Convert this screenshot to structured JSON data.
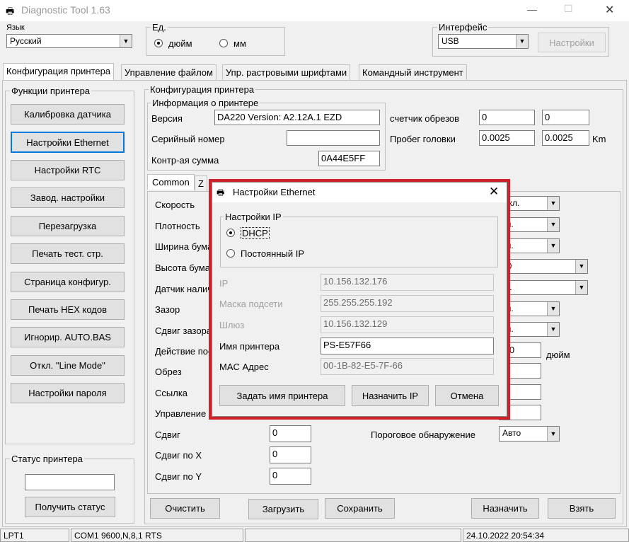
{
  "window": {
    "title": "Diagnostic Tool 1.63",
    "min": "—",
    "max": "☐",
    "close": "✕"
  },
  "lang": {
    "label": "Язык",
    "value": "Русский"
  },
  "units": {
    "label": "Ед.",
    "inch": "дюйм",
    "mm": "мм"
  },
  "iface": {
    "label": "Интерфейс",
    "value": "USB",
    "settings": "Настройки"
  },
  "tabs": [
    "Конфигурация принтера",
    "Управление файлом",
    "Упр. растровыми шрифтами",
    "Командный инструмент"
  ],
  "funcs": {
    "title": "Функции принтера",
    "items": [
      "Калибровка датчика",
      "Настройки Ethernet",
      "Настройки RTC",
      "Завод. настройки",
      "Перезагрузка",
      "Печать тест. стр.",
      "Страница конфигур.",
      "Печать HEX кодов",
      "Игнорир. AUTO.BAS",
      "Откл. \"Line Mode\"",
      "Настройки пароля"
    ]
  },
  "status_grp": {
    "title": "Статус принтера",
    "button": "Получить статус"
  },
  "config": {
    "title": "Конфигурация принтера",
    "info_title": "Информация о принтере",
    "version_label": "Версия",
    "version": "DA220 Version: A2.12A.1 EZD",
    "serial_label": "Серийный номер",
    "serial": "",
    "checksum_label": "Контр-ая сумма",
    "checksum": "0A44E5FF",
    "cut_label": "счетчик обрезов",
    "cut1": "0",
    "cut2": "0",
    "head_label": "Пробег головки",
    "head1": "0.0025",
    "head2": "0.0025",
    "head_unit": "Km"
  },
  "subtabs": {
    "common": "Common",
    "z": "Z"
  },
  "params": [
    "Скорость",
    "Плотность",
    "Ширина бумаги",
    "Высота бумаги",
    "Датчик наличия",
    "Зазор",
    "Сдвиг зазора",
    "Действие после",
    "Обрез",
    "Ссылка",
    "Управление"
  ],
  "right_vals": [
    "ыкл.",
    "кл.",
    "кл.",
    "50",
    "01",
    "кл.",
    "кл.",
    ",00"
  ],
  "inch_unit": "дюйм",
  "shift": {
    "s": "Сдвиг",
    "sx": "Сдвиг по X",
    "sy": "Сдвиг по Y",
    "v": "0",
    "vx": "0",
    "vy": "0"
  },
  "threshold": {
    "label": "Пороговое обнаружение",
    "value": "Авто"
  },
  "bottom": {
    "clear": "Очистить",
    "load": "Загрузить",
    "save": "Сохранить",
    "assign": "Назначить",
    "get": "Взять"
  },
  "statusbar": {
    "port": "LPT1",
    "com": "COM1 9600,N,8,1 RTS",
    "blank": "",
    "time": "24.10.2022 20:54:34"
  },
  "dialog": {
    "title": "Настройки Ethernet",
    "ip_group": "Настройки IP",
    "dhcp": "DHCP",
    "static": "Постоянный IP",
    "ip_label": "IP",
    "ip": "10.156.132.176",
    "mask_label": "Маска подсети",
    "mask": "255.255.255.192",
    "gw_label": "Шлюз",
    "gw": "10.156.132.129",
    "name_label": "Имя принтера",
    "name": "PS-E57F66",
    "mac_label": "MAC Адрес",
    "mac": "00-1B-82-E5-7F-66",
    "set_name": "Задать имя принтера",
    "assign_ip": "Назначить IP",
    "cancel": "Отмена",
    "highlight": "#d0202a"
  }
}
